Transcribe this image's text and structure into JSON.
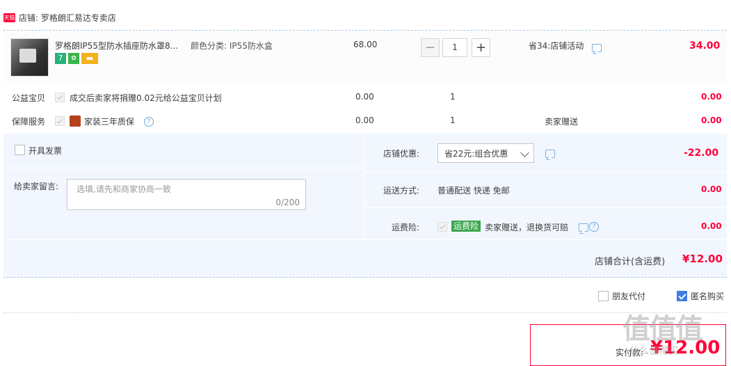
{
  "shop": {
    "badge": "天猫",
    "label": "店铺: 罗格朗汇易达专卖店"
  },
  "item": {
    "title": "罗格朗IP55型防水插座防水罩8...",
    "variant": "颜色分类: IP55防水盒",
    "price": "68.00",
    "quantity": "1",
    "promo": "省34:店铺活动",
    "subtotal": "34.00",
    "badges": [
      "7",
      "warranty-icon",
      "card-icon"
    ]
  },
  "charity": {
    "label": "公益宝贝",
    "text": "成交后卖家将捐赠0.02元给公益宝贝计划",
    "price": "0.00",
    "qty": "1",
    "total": "0.00"
  },
  "service": {
    "label": "保障服务",
    "text": "家装三年质保",
    "price": "0.00",
    "qty": "1",
    "note": "卖家赠送",
    "total": "0.00"
  },
  "invoice": {
    "label": "开具发票"
  },
  "message": {
    "label": "给卖家留言:",
    "placeholder": "选填,请先和商家协商一致",
    "counter": "0/200"
  },
  "discount": {
    "label": "店铺优惠:",
    "value": "省22元:组合优惠",
    "amount": "-22.00"
  },
  "shipping": {
    "label": "运送方式:",
    "value": "普通配送 快递 免邮",
    "amount": "0.00"
  },
  "insurance": {
    "label": "运费险:",
    "tag": "运费险",
    "text": "卖家赠送，退换货可赔",
    "amount": "0.00"
  },
  "shop_total": {
    "label": "店铺合计(含运费)",
    "amount": "¥12.00"
  },
  "options": {
    "friend_pay": "朋友代付",
    "anonymous": "匿名购买"
  },
  "payment": {
    "label": "实付款:",
    "amount": "¥12.00"
  },
  "watermark": {
    "big": "值值值",
    "small": "什么值得买"
  },
  "colors": {
    "accent": "#ff0036",
    "panel": "#f2f7ff",
    "link": "#3d7fe0"
  }
}
